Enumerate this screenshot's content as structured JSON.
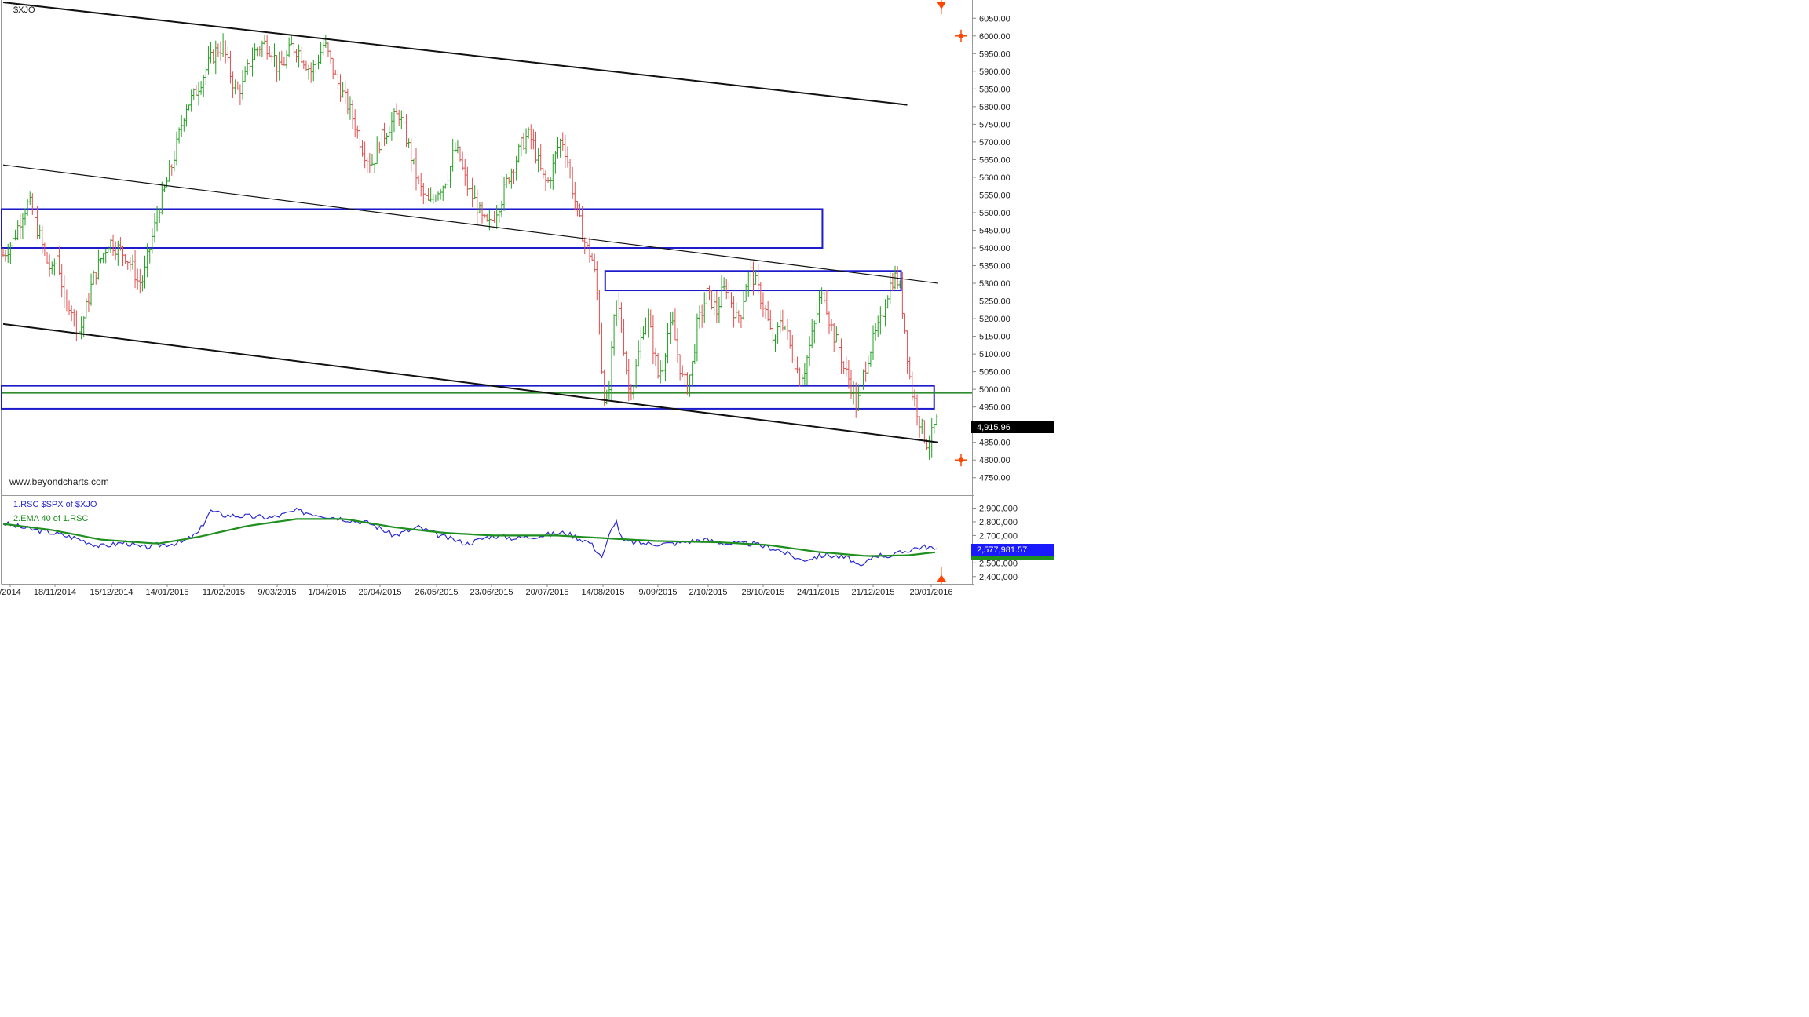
{
  "chart_data": [
    {
      "type": "candlestick",
      "symbol": "$XJO",
      "website": "www.beyondcharts.com",
      "ylim": [
        4725,
        6075
      ],
      "y_ticks": [
        "6050.00",
        "6000.00",
        "5950.00",
        "5900.00",
        "5850.00",
        "5800.00",
        "5750.00",
        "5700.00",
        "5650.00",
        "5600.00",
        "5550.00",
        "5500.00",
        "5450.00",
        "5400.00",
        "5350.00",
        "5300.00",
        "5250.00",
        "5200.00",
        "5150.00",
        "5100.00",
        "5050.00",
        "5000.00",
        "4950.00",
        "4900.00",
        "4850.00",
        "4800.00",
        "4750.00"
      ],
      "last_value_label": "4,915.96",
      "last_value": 4915.96,
      "x_labels": [
        "/2014",
        "18/11/2014",
        "15/12/2014",
        "14/01/2015",
        "11/02/2015",
        "9/03/2015",
        "1/04/2015",
        "29/04/2015",
        "26/05/2015",
        "23/06/2015",
        "20/07/2015",
        "14/08/2015",
        "9/09/2015",
        "2/10/2015",
        "28/10/2015",
        "24/11/2015",
        "21/12/2015",
        "20/01/2016"
      ],
      "close_path": [
        [
          0,
          5380
        ],
        [
          6,
          5420
        ],
        [
          12,
          5500
        ],
        [
          16,
          5530
        ],
        [
          19,
          5480
        ],
        [
          22,
          5440
        ],
        [
          26,
          5370
        ],
        [
          30,
          5330
        ],
        [
          33,
          5380
        ],
        [
          36,
          5300
        ],
        [
          38,
          5220
        ],
        [
          41,
          5250
        ],
        [
          44,
          5190
        ],
        [
          47,
          5160
        ],
        [
          51,
          5230
        ],
        [
          55,
          5310
        ],
        [
          60,
          5370
        ],
        [
          65,
          5420
        ],
        [
          70,
          5400
        ],
        [
          75,
          5380
        ],
        [
          80,
          5340
        ],
        [
          83,
          5300
        ],
        [
          86,
          5310
        ],
        [
          89,
          5380
        ],
        [
          92,
          5440
        ],
        [
          96,
          5520
        ],
        [
          100,
          5580
        ],
        [
          104,
          5640
        ],
        [
          108,
          5720
        ],
        [
          112,
          5800
        ],
        [
          117,
          5830
        ],
        [
          122,
          5880
        ],
        [
          127,
          5930
        ],
        [
          131,
          5960
        ],
        [
          135,
          5970
        ],
        [
          139,
          5900
        ],
        [
          143,
          5840
        ],
        [
          147,
          5860
        ],
        [
          151,
          5920
        ],
        [
          155,
          5960
        ],
        [
          160,
          5980
        ],
        [
          165,
          5960
        ],
        [
          169,
          5900
        ],
        [
          173,
          5930
        ],
        [
          177,
          5970
        ],
        [
          181,
          5960
        ],
        [
          185,
          5930
        ],
        [
          189,
          5900
        ],
        [
          193,
          5930
        ],
        [
          197,
          5980
        ],
        [
          200,
          5940
        ],
        [
          204,
          5880
        ],
        [
          208,
          5840
        ],
        [
          212,
          5800
        ],
        [
          216,
          5750
        ],
        [
          220,
          5690
        ],
        [
          224,
          5650
        ],
        [
          227,
          5640
        ],
        [
          231,
          5700
        ],
        [
          235,
          5730
        ],
        [
          239,
          5760
        ],
        [
          243,
          5780
        ],
        [
          247,
          5720
        ],
        [
          251,
          5650
        ],
        [
          255,
          5580
        ],
        [
          259,
          5540
        ],
        [
          262,
          5520
        ],
        [
          266,
          5560
        ],
        [
          270,
          5580
        ],
        [
          274,
          5620
        ],
        [
          277,
          5680
        ],
        [
          280,
          5660
        ],
        [
          283,
          5600
        ],
        [
          286,
          5560
        ],
        [
          290,
          5530
        ],
        [
          294,
          5480
        ],
        [
          298,
          5460
        ],
        [
          302,
          5500
        ],
        [
          306,
          5540
        ],
        [
          310,
          5600
        ],
        [
          314,
          5640
        ],
        [
          318,
          5690
        ],
        [
          322,
          5720
        ],
        [
          325,
          5700
        ],
        [
          328,
          5650
        ],
        [
          331,
          5600
        ],
        [
          334,
          5580
        ],
        [
          337,
          5620
        ],
        [
          340,
          5680
        ],
        [
          343,
          5710
        ],
        [
          346,
          5660
        ],
        [
          349,
          5580
        ],
        [
          352,
          5510
        ],
        [
          355,
          5450
        ],
        [
          358,
          5400
        ],
        [
          361,
          5380
        ],
        [
          364,
          5300
        ],
        [
          366,
          5180
        ],
        [
          368,
          5020
        ],
        [
          370,
          4950
        ],
        [
          372,
          5000
        ],
        [
          374,
          5130
        ],
        [
          376,
          5250
        ],
        [
          378,
          5220
        ],
        [
          380,
          5160
        ],
        [
          382,
          5080
        ],
        [
          384,
          5000
        ],
        [
          387,
          5020
        ],
        [
          390,
          5100
        ],
        [
          393,
          5180
        ],
        [
          396,
          5200
        ],
        [
          399,
          5120
        ],
        [
          402,
          5040
        ],
        [
          405,
          5070
        ],
        [
          408,
          5160
        ],
        [
          411,
          5180
        ],
        [
          414,
          5100
        ],
        [
          417,
          5030
        ],
        [
          420,
          5010
        ],
        [
          423,
          5070
        ],
        [
          426,
          5180
        ],
        [
          429,
          5220
        ],
        [
          432,
          5270
        ],
        [
          435,
          5250
        ],
        [
          438,
          5220
        ],
        [
          441,
          5270
        ],
        [
          444,
          5290
        ],
        [
          447,
          5250
        ],
        [
          450,
          5200
        ],
        [
          453,
          5220
        ],
        [
          456,
          5300
        ],
        [
          459,
          5330
        ],
        [
          462,
          5300
        ],
        [
          465,
          5260
        ],
        [
          468,
          5220
        ],
        [
          471,
          5160
        ],
        [
          474,
          5130
        ],
        [
          477,
          5200
        ],
        [
          480,
          5180
        ],
        [
          483,
          5120
        ],
        [
          486,
          5080
        ],
        [
          489,
          5030
        ],
        [
          492,
          5060
        ],
        [
          495,
          5120
        ],
        [
          498,
          5180
        ],
        [
          501,
          5250
        ],
        [
          504,
          5270
        ],
        [
          507,
          5200
        ],
        [
          510,
          5150
        ],
        [
          513,
          5120
        ],
        [
          516,
          5060
        ],
        [
          519,
          5030
        ],
        [
          522,
          4990
        ],
        [
          524,
          4940
        ],
        [
          526,
          5000
        ],
        [
          529,
          5060
        ],
        [
          532,
          5110
        ],
        [
          535,
          5150
        ],
        [
          538,
          5180
        ],
        [
          541,
          5240
        ],
        [
          544,
          5290
        ],
        [
          547,
          5320
        ],
        [
          550,
          5300
        ],
        [
          552,
          5230
        ],
        [
          554,
          5150
        ],
        [
          556,
          5050
        ],
        [
          558,
          4990
        ],
        [
          560,
          4960
        ],
        [
          562,
          4920
        ],
        [
          564,
          4890
        ],
        [
          566,
          4860
        ],
        [
          568,
          4840
        ],
        [
          570,
          4870
        ],
        [
          572,
          4900
        ],
        [
          574,
          4915.96
        ]
      ],
      "channels": [
        {
          "name": "upper-channel",
          "from": [
            "2014-10-27",
            6095
          ],
          "to": [
            "2016-01-07",
            5805
          ]
        },
        {
          "name": "middle-channel",
          "from": [
            "2014-10-27",
            5635
          ],
          "to": [
            "2016-01-22",
            5300
          ]
        },
        {
          "name": "lower-channel",
          "from": [
            "2014-10-27",
            5185
          ],
          "to": [
            "2016-01-22",
            4850
          ]
        }
      ],
      "zones": [
        {
          "name": "zone-5500",
          "x_end": "2015-11-27",
          "y_low": 5400,
          "y_high": 5510
        },
        {
          "name": "zone-5300",
          "x_start": "2015-08-14",
          "x_end": "2016-01-04",
          "y_low": 5280,
          "y_high": 5335
        },
        {
          "name": "zone-4980",
          "x_end": "2016-01-20",
          "y_low": 4945,
          "y_high": 5010
        }
      ],
      "support_line": 4990,
      "colors": {
        "up": "#22a022",
        "down": "#e05050",
        "zone": "#1c1ccc",
        "channel": "#111111",
        "support": "#2e8b2e",
        "marker": "#ff4500"
      }
    },
    {
      "type": "line",
      "name": "relative-strength",
      "legend": [
        "1.RSC  $SPX of $XJO",
        "2.EMA 40  of 1.RSC"
      ],
      "ylim": [
        2370000,
        2960000
      ],
      "y_ticks": [
        "2,900,000",
        "2,800,000",
        "2,700,000",
        "2,600,000",
        "2,500,000",
        "2,400,000"
      ],
      "last_rsc_label": "2,577,981.57",
      "series": [
        {
          "name": "1.RSC  $SPX of $XJO",
          "color": "#2a2ad0",
          "points": [
            [
              0,
              2790
            ],
            [
              15,
              2750
            ],
            [
              30,
              2720
            ],
            [
              45,
              2680
            ],
            [
              60,
              2620
            ],
            [
              75,
              2650
            ],
            [
              85,
              2610
            ],
            [
              95,
              2630
            ],
            [
              110,
              2650
            ],
            [
              120,
              2720
            ],
            [
              127,
              2880
            ],
            [
              135,
              2850
            ],
            [
              150,
              2840
            ],
            [
              165,
              2830
            ],
            [
              180,
              2880
            ],
            [
              195,
              2850
            ],
            [
              210,
              2820
            ],
            [
              225,
              2790
            ],
            [
              240,
              2700
            ],
            [
              255,
              2760
            ],
            [
              270,
              2690
            ],
            [
              285,
              2640
            ],
            [
              300,
              2700
            ],
            [
              315,
              2680
            ],
            [
              330,
              2700
            ],
            [
              345,
              2720
            ],
            [
              360,
              2650
            ],
            [
              368,
              2540
            ],
            [
              372,
              2700
            ],
            [
              376,
              2820
            ],
            [
              380,
              2660
            ],
            [
              395,
              2640
            ],
            [
              410,
              2640
            ],
            [
              430,
              2670
            ],
            [
              445,
              2640
            ],
            [
              460,
              2640
            ],
            [
              475,
              2600
            ],
            [
              490,
              2520
            ],
            [
              505,
              2560
            ],
            [
              520,
              2530
            ],
            [
              526,
              2460
            ],
            [
              535,
              2560
            ],
            [
              545,
              2550
            ],
            [
              560,
              2610
            ],
            [
              568,
              2620
            ],
            [
              574,
              2580
            ]
          ]
        },
        {
          "name": "2.EMA 40  of 1.RSC",
          "color": "#1f8f1f",
          "points": [
            [
              0,
              2785
            ],
            [
              30,
              2740
            ],
            [
              60,
              2670
            ],
            [
              95,
              2640
            ],
            [
              120,
              2690
            ],
            [
              150,
              2770
            ],
            [
              180,
              2820
            ],
            [
              210,
              2820
            ],
            [
              240,
              2760
            ],
            [
              270,
              2720
            ],
            [
              300,
              2700
            ],
            [
              340,
              2700
            ],
            [
              370,
              2680
            ],
            [
              400,
              2660
            ],
            [
              440,
              2650
            ],
            [
              470,
              2630
            ],
            [
              500,
              2580
            ],
            [
              530,
              2550
            ],
            [
              555,
              2555
            ],
            [
              574,
              2580
            ]
          ]
        }
      ]
    }
  ]
}
